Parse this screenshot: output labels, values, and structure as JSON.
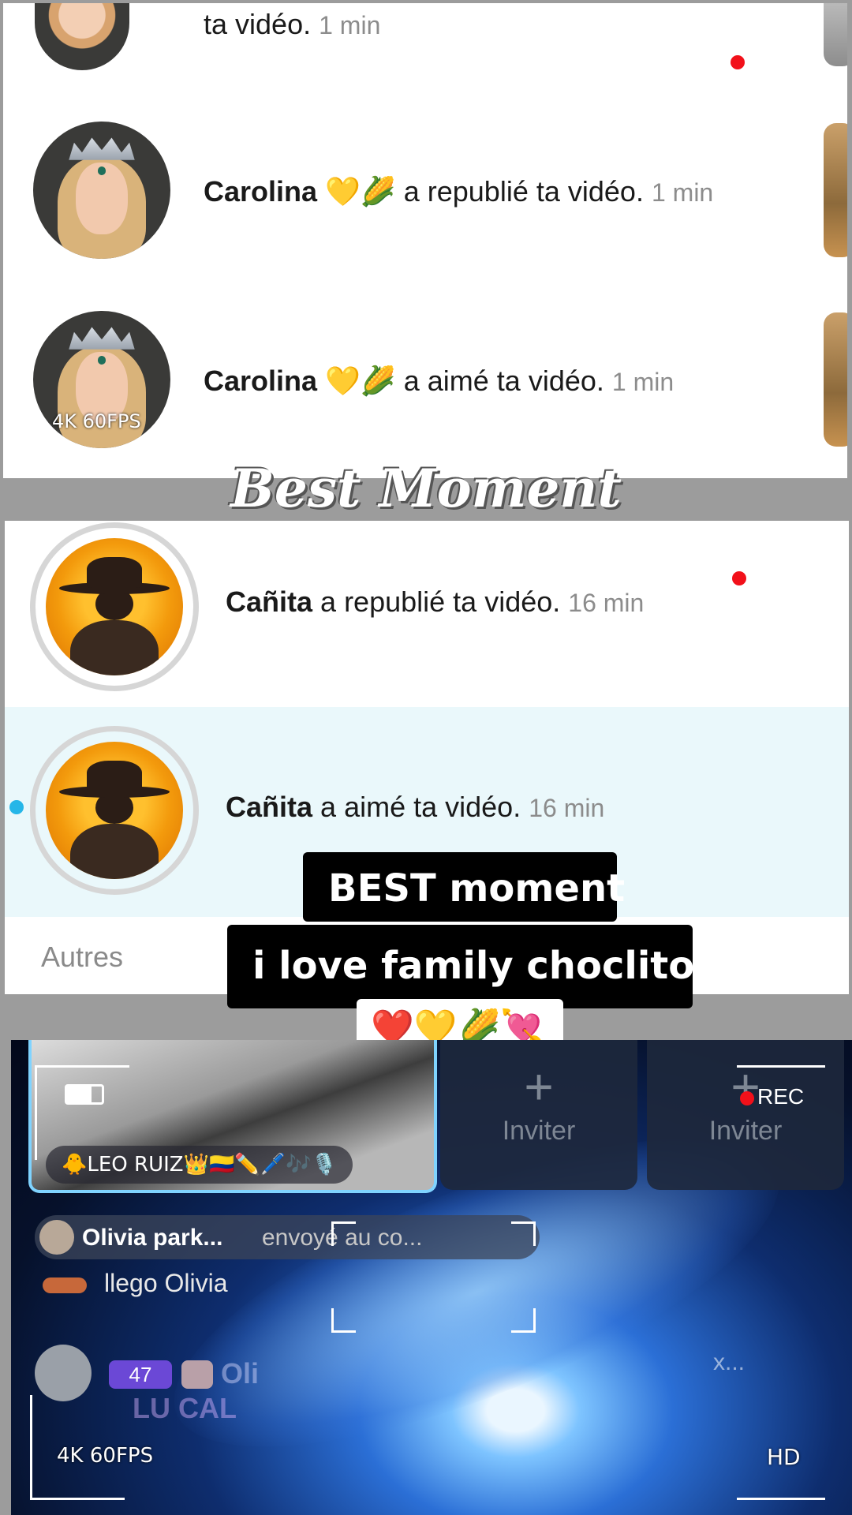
{
  "notifications_top": [
    {
      "name": "",
      "action": "ta vidéo.",
      "time": "1 min"
    },
    {
      "name": "Carolina",
      "emoji": "💛🌽",
      "action": "a republié ta vidéo.",
      "time": "1 min"
    },
    {
      "name": "Carolina",
      "emoji": "💛🌽",
      "action": "a aimé ta vidéo.",
      "time": "1 min"
    }
  ],
  "overlay_title": "Best Moment",
  "notifications_mid": [
    {
      "name": "Cañita",
      "action": "a republié ta vidéo.",
      "time": "16 min"
    },
    {
      "name": "Cañita",
      "action": "a aimé ta vidéo.",
      "time": "16 min"
    }
  ],
  "section_others": "Autres",
  "caption": {
    "line1": "BEST moment",
    "line2": "i love family choclitos",
    "emojis": "❤️💛🌽💘"
  },
  "watermark": {
    "quality": "4K 60FPS",
    "rec": "REC",
    "hd": "HD"
  },
  "live": {
    "host_name": "🐥LEO RUIZ👑🇨🇴✏️🖊️🎶🎙️",
    "invite_label": "Inviter",
    "chat": [
      {
        "user": "Olivia park...",
        "text": "envoyé au co..."
      },
      {
        "user": "",
        "text": "llego Olivia"
      }
    ],
    "level_badge": "47",
    "partial_name": "Oli",
    "partial_name2": "LU CAL",
    "close_hint": "x..."
  },
  "colors": {
    "red_dot": "#f2101a",
    "blue_dot": "#26b6e8",
    "highlight_row": "#eaf8fb"
  }
}
